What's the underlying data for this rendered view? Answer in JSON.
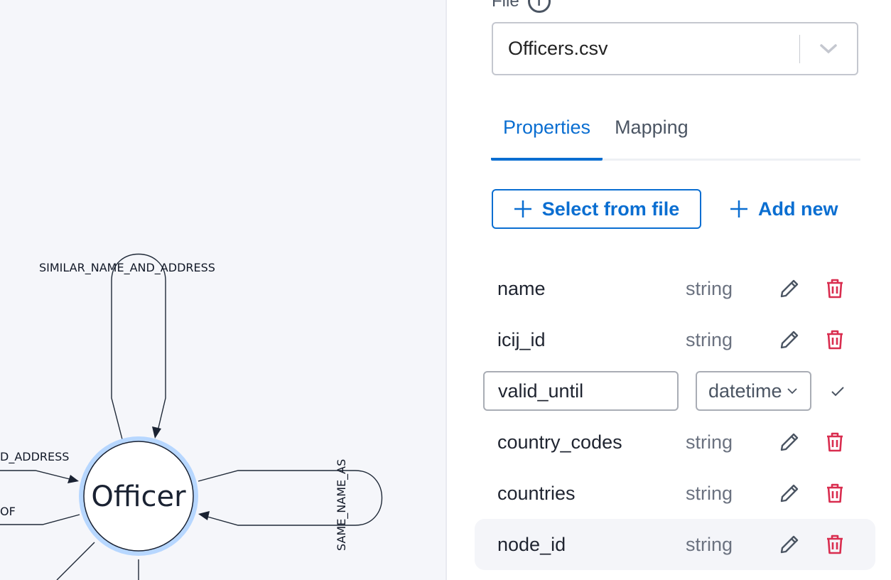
{
  "graph": {
    "node": {
      "label": "Officer",
      "ring_color": "#b7d7ff",
      "fill": "#ffffff",
      "stroke": "#1a2232"
    },
    "edges": [
      {
        "label": "SIMILAR_NAME_AND_ADDRESS",
        "kind": "self-loop-top"
      },
      {
        "label": "SAME_NAME_AS",
        "kind": "self-loop-right"
      },
      {
        "label": "D_ADDRESS",
        "kind": "incoming-left-partial"
      },
      {
        "label": "OF",
        "kind": "outgoing-left-partial"
      }
    ]
  },
  "panel": {
    "file_label": "File",
    "file_info_icon": "info-icon",
    "file_select": {
      "value": "Officers.csv",
      "icon": "chevron-down-icon"
    },
    "tabs": [
      {
        "label": "Properties",
        "active": true
      },
      {
        "label": "Mapping",
        "active": false
      }
    ],
    "buttons": {
      "select_from_file": "Select from file",
      "add_new": "Add new"
    },
    "properties": [
      {
        "name": "name",
        "type": "string"
      },
      {
        "name": "icij_id",
        "type": "string"
      },
      {
        "name": "valid_until",
        "type": "datetime",
        "editing": true
      },
      {
        "name": "country_codes",
        "type": "string"
      },
      {
        "name": "countries",
        "type": "string"
      },
      {
        "name": "node_id",
        "type": "string",
        "hovered": true
      }
    ],
    "colors": {
      "accent": "#0a6ed1",
      "delete": "#d92d4f",
      "icon": "#4b5563"
    }
  }
}
